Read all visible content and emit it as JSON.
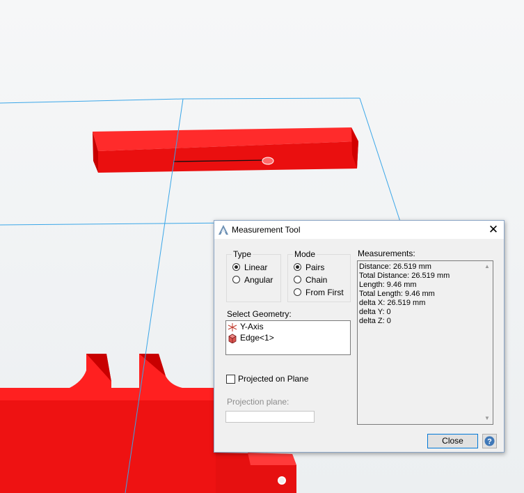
{
  "dialog": {
    "title": "Measurement Tool",
    "type_group": {
      "label": "Type",
      "options": [
        {
          "label": "Linear",
          "selected": true
        },
        {
          "label": "Angular",
          "selected": false
        }
      ]
    },
    "mode_group": {
      "label": "Mode",
      "options": [
        {
          "label": "Pairs",
          "selected": true
        },
        {
          "label": "Chain",
          "selected": false
        },
        {
          "label": "From First",
          "selected": false
        }
      ]
    },
    "select_geometry": {
      "label": "Select Geometry:",
      "items": [
        {
          "label": "Y-Axis",
          "icon": "axis-icon"
        },
        {
          "label": "Edge<1>",
          "icon": "edge-cube-icon"
        }
      ]
    },
    "measurements": {
      "label": "Measurements:",
      "lines": [
        "Distance: 26.519 mm",
        "Total Distance: 26.519 mm",
        "Length: 9.46 mm",
        "Total Length: 9.46 mm",
        "delta X: 26.519 mm",
        "delta Y:  0",
        "delta Z:  0"
      ]
    },
    "projected_checkbox": {
      "label": "Projected on Plane",
      "checked": false
    },
    "projection_plane": {
      "label": "Projection plane:",
      "value": ""
    },
    "close_button": "Close",
    "help_icon": "help-icon"
  },
  "colors": {
    "part_red": "#ff1a1a",
    "background": "#f3f5f6",
    "axis_line": "#3aa6e8",
    "dialog_bg": "#f0f0f0"
  }
}
